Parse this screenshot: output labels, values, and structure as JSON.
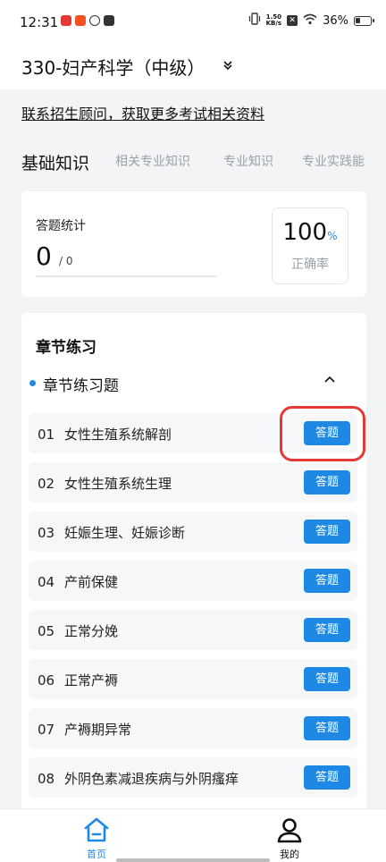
{
  "status_bar": {
    "time": "12:31",
    "network_speed": "1.50",
    "network_unit": "KB/s",
    "battery_percent": "36%",
    "battery_level": 0.36
  },
  "header": {
    "title": "330-妇产科学（中级）",
    "dropdown_icon": "chevron-down-icon"
  },
  "banner": {
    "link_text": "联系招生顾问，获取更多考试相关资料"
  },
  "tabs": [
    {
      "label": "基础知识",
      "active": true
    },
    {
      "label": "相关专业知识",
      "active": false
    },
    {
      "label": "专业知识",
      "active": false
    },
    {
      "label": "专业实践能",
      "active": false
    }
  ],
  "stats": {
    "label": "答题统计",
    "answered": "0",
    "total": "/ 0",
    "rate_value": "100",
    "rate_unit": "%",
    "rate_label": "正确率"
  },
  "chapter": {
    "title": "章节练习",
    "section_label": "章节练习题",
    "items": [
      {
        "num": "01",
        "name": "女性生殖系统解剖",
        "button": "答题"
      },
      {
        "num": "02",
        "name": "女性生殖系统生理",
        "button": "答题"
      },
      {
        "num": "03",
        "name": "妊娠生理、妊娠诊断",
        "button": "答题"
      },
      {
        "num": "04",
        "name": "产前保健",
        "button": "答题"
      },
      {
        "num": "05",
        "name": "正常分娩",
        "button": "答题"
      },
      {
        "num": "06",
        "name": "正常产褥",
        "button": "答题"
      },
      {
        "num": "07",
        "name": "产褥期异常",
        "button": "答题"
      },
      {
        "num": "08",
        "name": "外阴色素减退疾病与外阴瘙痒",
        "button": "答题"
      }
    ]
  },
  "bottom_nav": {
    "home_label": "首页",
    "mine_label": "我的"
  },
  "colors": {
    "accent": "#1e88e5",
    "highlight": "#e53935"
  }
}
